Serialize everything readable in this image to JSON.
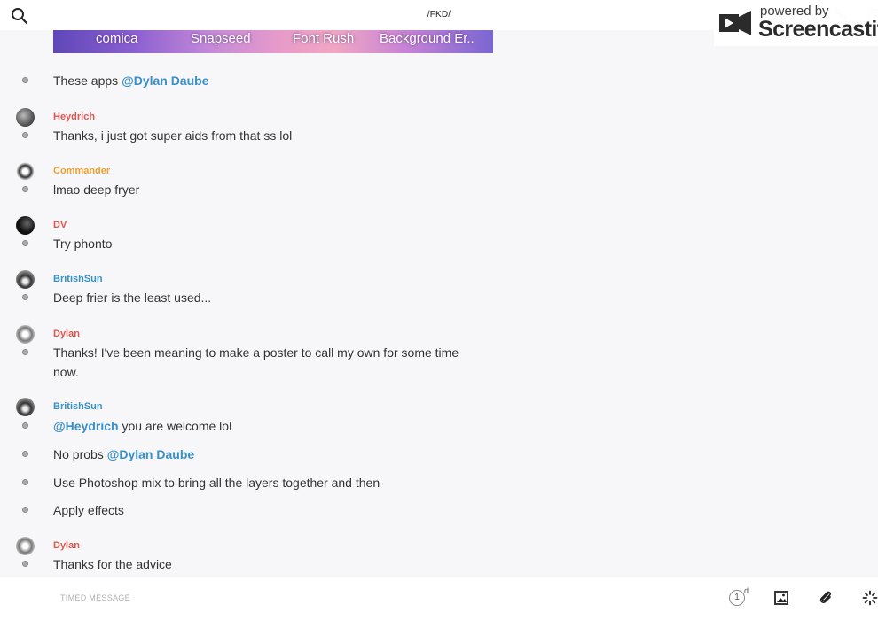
{
  "header": {
    "channel_title": "/FKD/",
    "search_icon": "search-icon",
    "phone_icon": "phone-icon",
    "info_icon": "info-icon"
  },
  "watermark": {
    "small_text": "powered by",
    "big_text": "Screencastify"
  },
  "banner": {
    "labels": [
      "comica",
      "Snapseed",
      "Font Rush",
      "Background Er.."
    ]
  },
  "messages": [
    {
      "text_before": "These apps ",
      "mention": "@Dylan Daube"
    },
    {
      "user": "Heydrich",
      "user_color": "#e0574f",
      "text": "Thanks, i just got super aids from that ss lol"
    },
    {
      "user": "Commander",
      "user_color": "#f0a030",
      "text": "lmao deep fryer"
    },
    {
      "user": "DV",
      "user_color": "#e0574f",
      "text": "Try phonto"
    },
    {
      "user": "BritishSun",
      "user_color": "#3a8fc7",
      "text": "Deep frier is the least used..."
    },
    {
      "user": "Dylan",
      "user_color": "#e0574f",
      "text": "Thanks! I've been meaning to make a poster to call my own for some time now."
    },
    {
      "user": "BritishSun",
      "user_color": "#3a8fc7",
      "mention": "@Heydrich",
      "text_after": " you are welcome lol"
    },
    {
      "text_before": "No probs ",
      "mention": "@Dylan Daube"
    },
    {
      "text": "Use Photoshop mix to bring all the layers together and then"
    },
    {
      "text": "Apply effects"
    },
    {
      "user": "Dylan",
      "user_color": "#e0574f",
      "text": "Thanks for the advice"
    }
  ],
  "composer": {
    "placeholder": "TIMED MESSAGE",
    "timer_value": "1",
    "timer_unit": "d",
    "image_icon": "image-icon",
    "attach_icon": "paperclip-icon",
    "sparkle_icon": "sparkle-icon"
  },
  "colors": {
    "mention": "#3a8fc7",
    "user_red": "#e0574f",
    "user_orange": "#f0a030",
    "user_blue": "#3a8fc7"
  }
}
